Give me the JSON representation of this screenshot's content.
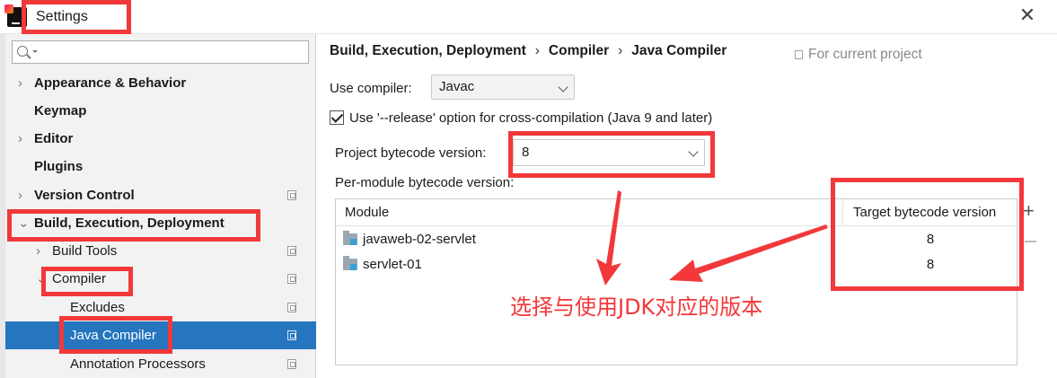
{
  "window": {
    "title": "Settings"
  },
  "sidebar": {
    "search_placeholder": "",
    "items": [
      {
        "label": "Appearance & Behavior",
        "chevron": "›"
      },
      {
        "label": "Keymap"
      },
      {
        "label": "Editor",
        "chevron": "›"
      },
      {
        "label": "Plugins"
      },
      {
        "label": "Version Control",
        "chevron": "›"
      },
      {
        "label": "Build, Execution, Deployment",
        "chevron": "⌄"
      },
      {
        "label": "Build Tools",
        "chevron": "›"
      },
      {
        "label": "Compiler",
        "chevron": "⌄"
      },
      {
        "label": "Excludes"
      },
      {
        "label": "Java Compiler"
      },
      {
        "label": "Annotation Processors"
      }
    ]
  },
  "breadcrumb": {
    "parts": [
      "Build, Execution, Deployment",
      "Compiler",
      "Java Compiler"
    ],
    "separator": "›",
    "scope_note": "For current project"
  },
  "form": {
    "use_compiler_label": "Use compiler:",
    "use_compiler_value": "Javac",
    "release_option_label": "Use '--release' option for cross-compilation (Java 9 and later)",
    "release_option_checked": true,
    "project_bytecode_label": "Project bytecode version:",
    "project_bytecode_value": "8",
    "per_module_label": "Per-module bytecode version:"
  },
  "module_table": {
    "columns": [
      "Module",
      "Target bytecode version"
    ],
    "rows": [
      {
        "module": "javaweb-02-servlet",
        "target": "8"
      },
      {
        "module": "servlet-01",
        "target": "8"
      }
    ]
  },
  "annotation": {
    "text": "选择与使用JDK对应的版本",
    "color": "#f2383a"
  },
  "colors": {
    "selection": "#2675bf",
    "annotation_red": "#f2383a"
  }
}
